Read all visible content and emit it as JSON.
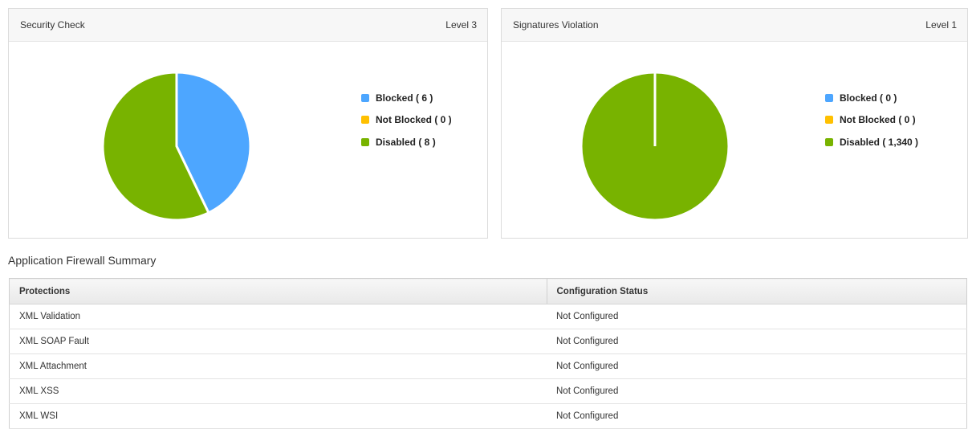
{
  "colors": {
    "blocked": "#4da6ff",
    "not_blocked": "#ffc000",
    "disabled": "#78b300"
  },
  "panels": [
    {
      "title": "Security Check",
      "level": "Level 3",
      "legend": [
        {
          "label": "Blocked ( 6 )",
          "color": "#4da6ff"
        },
        {
          "label": "Not Blocked ( 0 )",
          "color": "#ffc000"
        },
        {
          "label": "Disabled ( 8 )",
          "color": "#78b300"
        }
      ]
    },
    {
      "title": "Signatures Violation",
      "level": "Level 1",
      "legend": [
        {
          "label": "Blocked ( 0 )",
          "color": "#4da6ff"
        },
        {
          "label": "Not Blocked ( 0 )",
          "color": "#ffc000"
        },
        {
          "label": "Disabled ( 1,340 )",
          "color": "#78b300"
        }
      ]
    }
  ],
  "chart_data": [
    {
      "type": "pie",
      "categories": [
        "Blocked",
        "Not Blocked",
        "Disabled"
      ],
      "values": [
        6,
        0,
        8
      ],
      "colors": [
        "#4da6ff",
        "#ffc000",
        "#78b300"
      ]
    },
    {
      "type": "pie",
      "categories": [
        "Blocked",
        "Not Blocked",
        "Disabled"
      ],
      "values": [
        0,
        0,
        1340
      ],
      "colors": [
        "#4da6ff",
        "#ffc000",
        "#78b300"
      ]
    }
  ],
  "summary": {
    "title": "Application Firewall Summary",
    "columns": [
      "Protections",
      "Configuration Status"
    ],
    "rows": [
      [
        "XML Validation",
        "Not Configured"
      ],
      [
        "XML SOAP Fault",
        "Not Configured"
      ],
      [
        "XML Attachment",
        "Not Configured"
      ],
      [
        "XML XSS",
        "Not Configured"
      ],
      [
        "XML WSI",
        "Not Configured"
      ]
    ]
  }
}
